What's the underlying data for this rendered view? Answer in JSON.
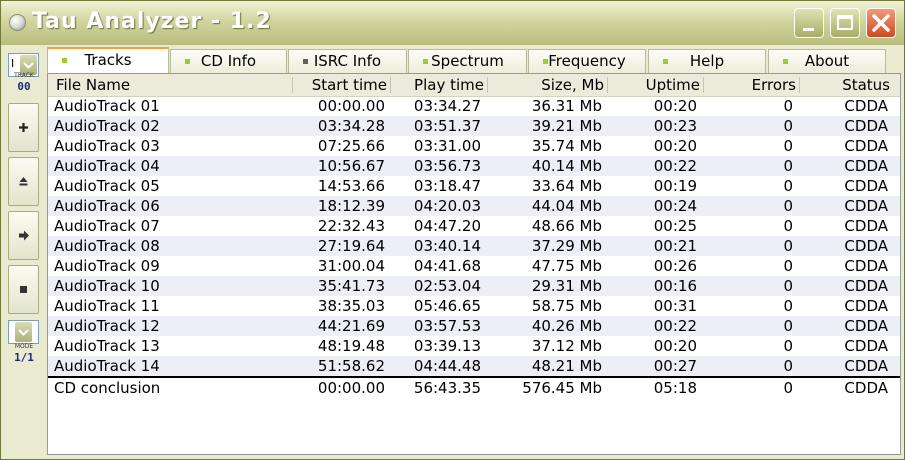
{
  "window": {
    "title": "Tau Analyzer - 1.2"
  },
  "sidebar": {
    "track_label": "TRACK",
    "track_value": "00",
    "mode_label": "MODE",
    "mode_value": "1/1",
    "buttons": [
      "+",
      "▲",
      "➜",
      "■"
    ]
  },
  "tabs": [
    {
      "label": "Tracks",
      "dot_color": "#9acd32",
      "active": true
    },
    {
      "label": "CD Info",
      "dot_color": "#9acd32",
      "active": false
    },
    {
      "label": "ISRC Info",
      "dot_color": "#606060",
      "active": false
    },
    {
      "label": "Spectrum",
      "dot_color": "#9acd32",
      "active": false
    },
    {
      "label": "Frequency",
      "dot_color": "#9acd32",
      "active": false
    },
    {
      "label": "Help",
      "dot_color": "#9acd32",
      "active": false
    },
    {
      "label": "About",
      "dot_color": "#9acd32",
      "active": false
    }
  ],
  "table": {
    "columns": [
      "File Name",
      "Start time",
      "Play time",
      "Size, Mb",
      "Uptime",
      "Errors",
      "Status"
    ],
    "rows": [
      [
        "AudioTrack 01",
        "00:00.00",
        "03:34.27",
        "36.31 Mb",
        "00:20",
        "0",
        "CDDA"
      ],
      [
        "AudioTrack 02",
        "03:34.28",
        "03:51.37",
        "39.21 Mb",
        "00:23",
        "0",
        "CDDA"
      ],
      [
        "AudioTrack 03",
        "07:25.66",
        "03:31.00",
        "35.74 Mb",
        "00:20",
        "0",
        "CDDA"
      ],
      [
        "AudioTrack 04",
        "10:56.67",
        "03:56.73",
        "40.14 Mb",
        "00:22",
        "0",
        "CDDA"
      ],
      [
        "AudioTrack 05",
        "14:53.66",
        "03:18.47",
        "33.64 Mb",
        "00:19",
        "0",
        "CDDA"
      ],
      [
        "AudioTrack 06",
        "18:12.39",
        "04:20.03",
        "44.04 Mb",
        "00:24",
        "0",
        "CDDA"
      ],
      [
        "AudioTrack 07",
        "22:32.43",
        "04:47.20",
        "48.66 Mb",
        "00:25",
        "0",
        "CDDA"
      ],
      [
        "AudioTrack 08",
        "27:19.64",
        "03:40.14",
        "37.29 Mb",
        "00:21",
        "0",
        "CDDA"
      ],
      [
        "AudioTrack 09",
        "31:00.04",
        "04:41.68",
        "47.75 Mb",
        "00:26",
        "0",
        "CDDA"
      ],
      [
        "AudioTrack 10",
        "35:41.73",
        "02:53.04",
        "29.31 Mb",
        "00:16",
        "0",
        "CDDA"
      ],
      [
        "AudioTrack 11",
        "38:35.03",
        "05:46.65",
        "58.75 Mb",
        "00:31",
        "0",
        "CDDA"
      ],
      [
        "AudioTrack 12",
        "44:21.69",
        "03:57.53",
        "40.26 Mb",
        "00:22",
        "0",
        "CDDA"
      ],
      [
        "AudioTrack 13",
        "48:19.48",
        "03:39.13",
        "37.12 Mb",
        "00:20",
        "0",
        "CDDA"
      ],
      [
        "AudioTrack 14",
        "51:58.62",
        "04:44.48",
        "48.21 Mb",
        "00:27",
        "0",
        "CDDA"
      ]
    ],
    "summary": [
      "CD conclusion",
      "00:00.00",
      "56:43.35",
      "576.45 Mb",
      "05:18",
      "0",
      "CDDA"
    ]
  }
}
